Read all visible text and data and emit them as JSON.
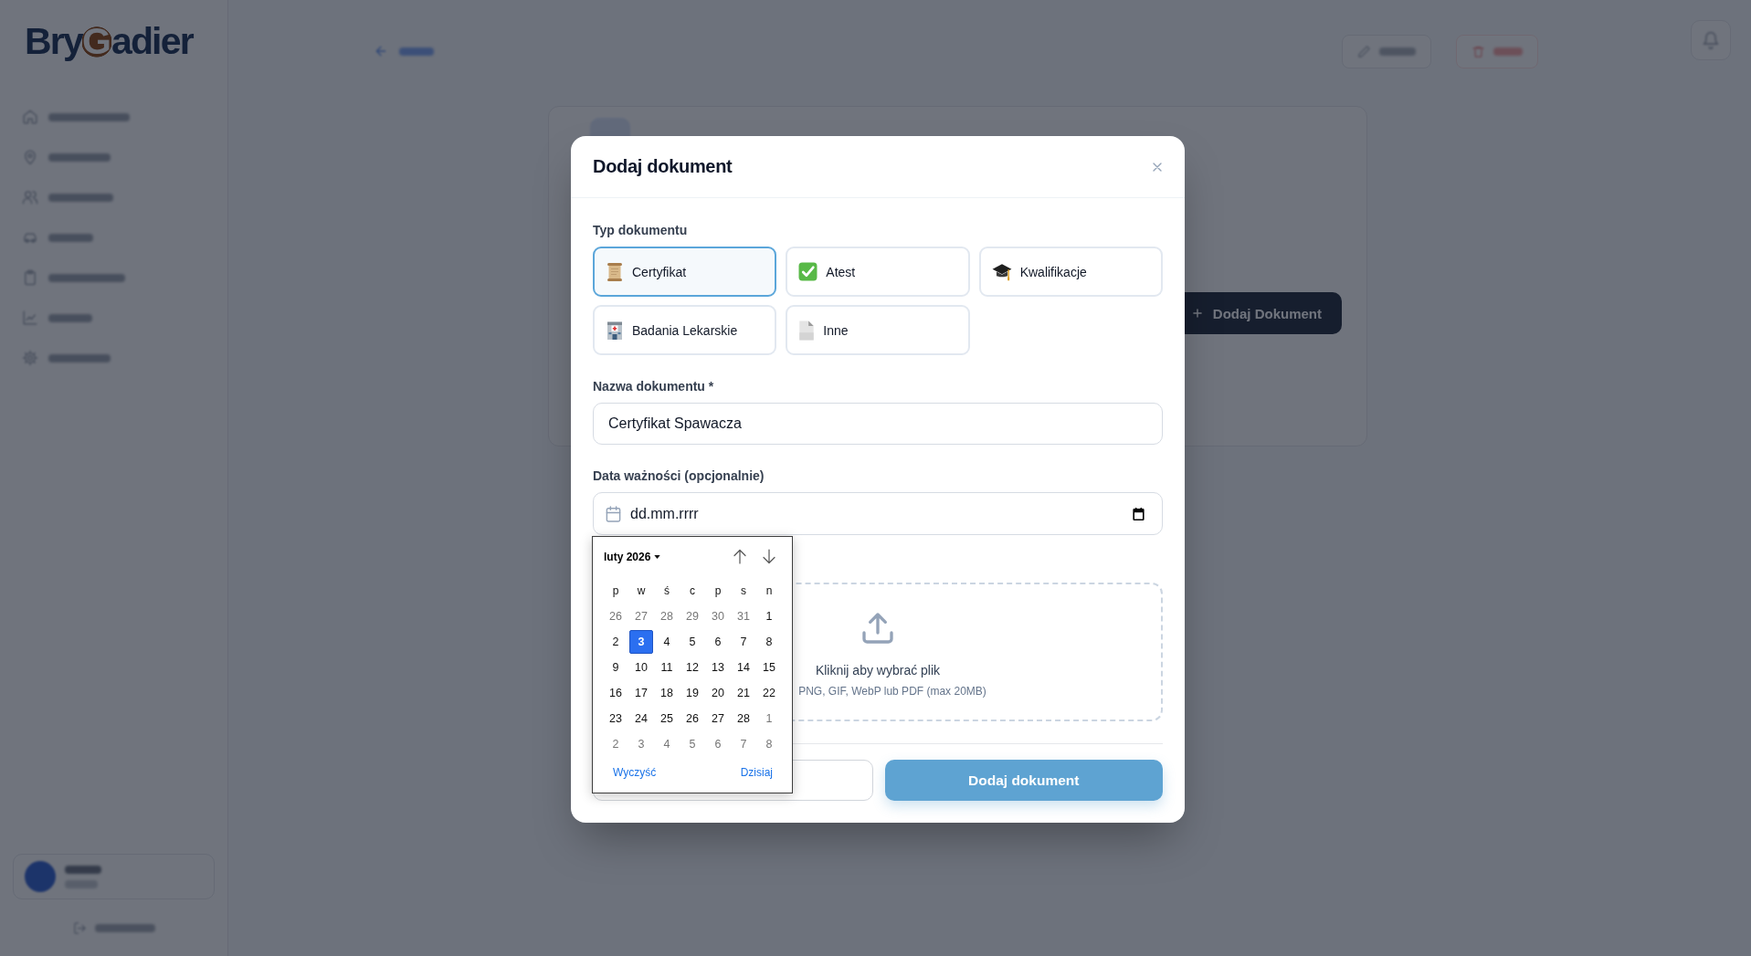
{
  "background_page": {
    "logo": {
      "lead": "Bry",
      "mark": "G",
      "tail": "adier"
    },
    "card": {
      "add_button": "Dodaj Dokument"
    }
  },
  "modal": {
    "title": "Dodaj dokument",
    "type_label": "Typ dokumentu",
    "types": [
      {
        "label": "Certyfikat",
        "selected": true
      },
      {
        "label": "Atest",
        "selected": false
      },
      {
        "label": "Kwalifikacje",
        "selected": false
      },
      {
        "label": "Badania Lekarskie",
        "selected": false
      },
      {
        "label": "Inne",
        "selected": false
      }
    ],
    "name_field": {
      "label": "Nazwa dokumentu *",
      "value": "Certyfikat Spawacza"
    },
    "expiry_field": {
      "label": "Data ważności (opcjonalnie)",
      "placeholder": "dd.mm.rrrr"
    },
    "upload": {
      "title": "Kliknij aby wybrać plik",
      "hint": "PNG, GIF, WebP lub PDF (max 20MB)"
    },
    "buttons": [
      {
        "kind": "secondary"
      },
      {
        "kind": "primary",
        "label": "Dodaj dokument"
      }
    ]
  },
  "date_picker": {
    "month": "luty 2026",
    "weekdays": [
      "p",
      "w",
      "ś",
      "c",
      "p",
      "s",
      "n"
    ],
    "weeks": [
      [
        {
          "day": "26",
          "outside": true,
          "selected": false
        },
        {
          "day": "27",
          "outside": true,
          "selected": false
        },
        {
          "day": "28",
          "outside": true,
          "selected": false
        },
        {
          "day": "29",
          "outside": true,
          "selected": false
        },
        {
          "day": "30",
          "outside": true,
          "selected": false
        },
        {
          "day": "31",
          "outside": true,
          "selected": false
        },
        {
          "day": "1",
          "outside": false,
          "selected": false
        }
      ],
      [
        {
          "day": "2",
          "outside": false,
          "selected": false
        },
        {
          "day": "3",
          "outside": false,
          "selected": true
        },
        {
          "day": "4",
          "outside": false,
          "selected": false
        },
        {
          "day": "5",
          "outside": false,
          "selected": false
        },
        {
          "day": "6",
          "outside": false,
          "selected": false
        },
        {
          "day": "7",
          "outside": false,
          "selected": false
        },
        {
          "day": "8",
          "outside": false,
          "selected": false
        }
      ],
      [
        {
          "day": "9",
          "outside": false,
          "selected": false
        },
        {
          "day": "10",
          "outside": false,
          "selected": false
        },
        {
          "day": "11",
          "outside": false,
          "selected": false
        },
        {
          "day": "12",
          "outside": false,
          "selected": false
        },
        {
          "day": "13",
          "outside": false,
          "selected": false
        },
        {
          "day": "14",
          "outside": false,
          "selected": false
        },
        {
          "day": "15",
          "outside": false,
          "selected": false
        }
      ],
      [
        {
          "day": "16",
          "outside": false,
          "selected": false
        },
        {
          "day": "17",
          "outside": false,
          "selected": false
        },
        {
          "day": "18",
          "outside": false,
          "selected": false
        },
        {
          "day": "19",
          "outside": false,
          "selected": false
        },
        {
          "day": "20",
          "outside": false,
          "selected": false
        },
        {
          "day": "21",
          "outside": false,
          "selected": false
        },
        {
          "day": "22",
          "outside": false,
          "selected": false
        }
      ],
      [
        {
          "day": "23",
          "outside": false,
          "selected": false
        },
        {
          "day": "24",
          "outside": false,
          "selected": false
        },
        {
          "day": "25",
          "outside": false,
          "selected": false
        },
        {
          "day": "26",
          "outside": false,
          "selected": false
        },
        {
          "day": "27",
          "outside": false,
          "selected": false
        },
        {
          "day": "28",
          "outside": false,
          "selected": false
        },
        {
          "day": "1",
          "outside": true,
          "selected": false
        }
      ],
      [
        {
          "day": "2",
          "outside": true,
          "selected": false
        },
        {
          "day": "3",
          "outside": true,
          "selected": false
        },
        {
          "day": "4",
          "outside": true,
          "selected": false
        },
        {
          "day": "5",
          "outside": true,
          "selected": false
        },
        {
          "day": "6",
          "outside": true,
          "selected": false
        },
        {
          "day": "7",
          "outside": true,
          "selected": false
        },
        {
          "day": "8",
          "outside": true,
          "selected": false
        }
      ]
    ],
    "actions": [
      "Wyczyść",
      "Dzisiaj"
    ]
  }
}
